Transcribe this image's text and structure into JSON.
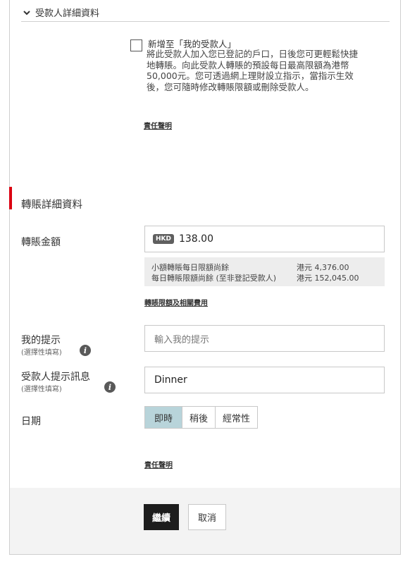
{
  "payee_section": {
    "title": "受款人詳細資料",
    "add_to_payees": {
      "title": "新增至「我的受款人」",
      "description": "將此受款人加入您已登記的戶口，日後您可更輕鬆快捷地轉賬。向此受款人轉賬的預設每日最高限額為港幣50,000元。您可透過網上理財設立指示，當指示生效後，您可隨時修改轉賬限額或刪除受款人。",
      "checked": false
    },
    "disclaimer_link": "責任聲明"
  },
  "transfer_section": {
    "title": "轉賬詳細資料",
    "amount": {
      "label": "轉賬金額",
      "currency": "HKD",
      "value": "138.00"
    },
    "limits": [
      {
        "label": "小額轉賬每日限額尚餘",
        "value": "港元 4,376.00"
      },
      {
        "label": "每日轉賬限額尚餘 (至非登記受款人)",
        "value": "港元 152,045.00"
      }
    ],
    "limits_link": "轉賬限額及相關費用",
    "my_reference": {
      "label": "我的提示",
      "sublabel": "(選擇性填寫)",
      "placeholder": "輸入我的提示",
      "value": ""
    },
    "payee_reference": {
      "label": "受款人提示訊息",
      "sublabel": "(選擇性填寫)",
      "value": "Dinner"
    },
    "date": {
      "label": "日期",
      "options": [
        "即時",
        "稍後",
        "經常性"
      ],
      "selected": "即時"
    },
    "disclaimer_link": "責任聲明"
  },
  "actions": {
    "continue_label": "繼續",
    "cancel_label": "取消"
  },
  "colors": {
    "accent_red": "#db0011",
    "selected_segment": "#b8d4da",
    "primary_button": "#1d1d1d"
  }
}
